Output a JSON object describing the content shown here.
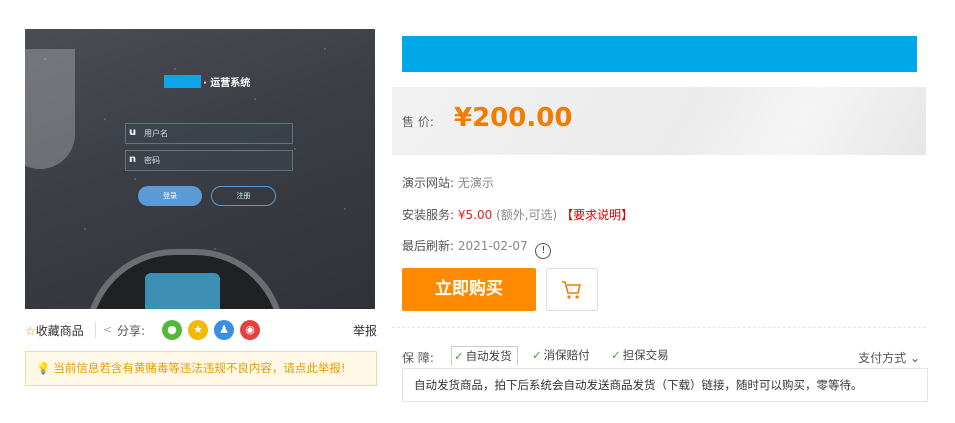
{
  "preview": {
    "system_title": "· 运营系统",
    "username_prefix": "u",
    "username_placeholder": "用户名",
    "password_prefix": "n",
    "password_placeholder": "密码",
    "login_label": "登录",
    "register_label": "注册"
  },
  "actions": {
    "favorite_label": "收藏商品",
    "share_label": "分享:",
    "report_label": "举报",
    "share_targets": [
      "wechat-icon",
      "qzone-icon",
      "qq-icon",
      "weibo-icon"
    ]
  },
  "warning": {
    "text": "当前信息若含有黄赌毒等违法违规不良内容，请点此举报!"
  },
  "price": {
    "label": "售  价:",
    "value": "¥200.00"
  },
  "info": {
    "demo_label": "演示网站:",
    "demo_value": "无演示",
    "install_label": "安装服务:",
    "install_price": "¥5.00",
    "install_note": "(额外,可选)",
    "install_link": "【要求说明】",
    "refresh_label": "最后刷新:",
    "refresh_value": "2021-02-07"
  },
  "buttons": {
    "buy_label": "立即购买"
  },
  "guarantee": {
    "label": "保  障:",
    "tags": [
      "自动发货",
      "消保赔付",
      "担保交易"
    ],
    "payment_label": "支付方式",
    "description": "自动发货商品，拍下后系统会自动发送商品发货（下载）链接，随时可以购买，零等待。"
  },
  "colors": {
    "accent_orange": "#ff8a00",
    "price_orange": "#f07c00",
    "redaction_blue": "#00a7e6"
  }
}
